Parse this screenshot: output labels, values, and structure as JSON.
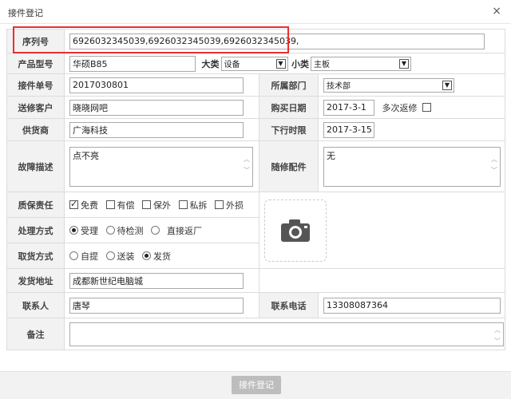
{
  "dialog": {
    "title": "接件登记",
    "close_glyph": "×"
  },
  "form": {
    "serial": {
      "label": "序列号",
      "value": "6926032345039,6926032345039,6926032345039,"
    },
    "model": {
      "label": "产品型号",
      "value": "华硕B85",
      "major_label": "大类",
      "major_value": "设备",
      "minor_label": "小类",
      "minor_value": "主板"
    },
    "order_no": {
      "label": "接件单号",
      "value": "2017030801"
    },
    "department": {
      "label": "所属部门",
      "value": "技术部"
    },
    "customer": {
      "label": "送修客户",
      "value": "晓晓网吧"
    },
    "purchase_date": {
      "label": "购买日期",
      "value": "2017-3-1",
      "repeat_label": "多次返修"
    },
    "supplier": {
      "label": "供货商",
      "value": "广海科技"
    },
    "deadline": {
      "label": "下行时限",
      "value": "2017-3-15"
    },
    "fault": {
      "label": "故障描述",
      "value": "点不亮"
    },
    "accessories": {
      "label": "随修配件",
      "value": "无"
    },
    "warranty": {
      "label": "质保责任",
      "options": [
        "免费",
        "有偿",
        "保外",
        "私拆",
        "外损"
      ],
      "checked": [
        true,
        false,
        false,
        false,
        false
      ]
    },
    "process": {
      "label": "处理方式",
      "options": [
        "受理",
        "待检测",
        "直接返厂"
      ],
      "selected": 0
    },
    "pickup": {
      "label": "取货方式",
      "options": [
        "自提",
        "送装",
        "发货"
      ],
      "selected": 2
    },
    "address": {
      "label": "发货地址",
      "value": "成都新世纪电脑城"
    },
    "contact": {
      "label": "联系人",
      "value": "唐琴"
    },
    "phone": {
      "label": "联系电话",
      "value": "13308087364"
    },
    "remark": {
      "label": "备注",
      "value": ""
    }
  },
  "footer": {
    "submit_label": "接件登记"
  },
  "icons": {
    "camera": "camera-icon",
    "close": "close-icon",
    "dropdown": "chevron-down-icon"
  },
  "colors": {
    "highlight": "#e8302f",
    "label_bg": "#f2f2f2",
    "button_bg": "#bdbdbd"
  }
}
